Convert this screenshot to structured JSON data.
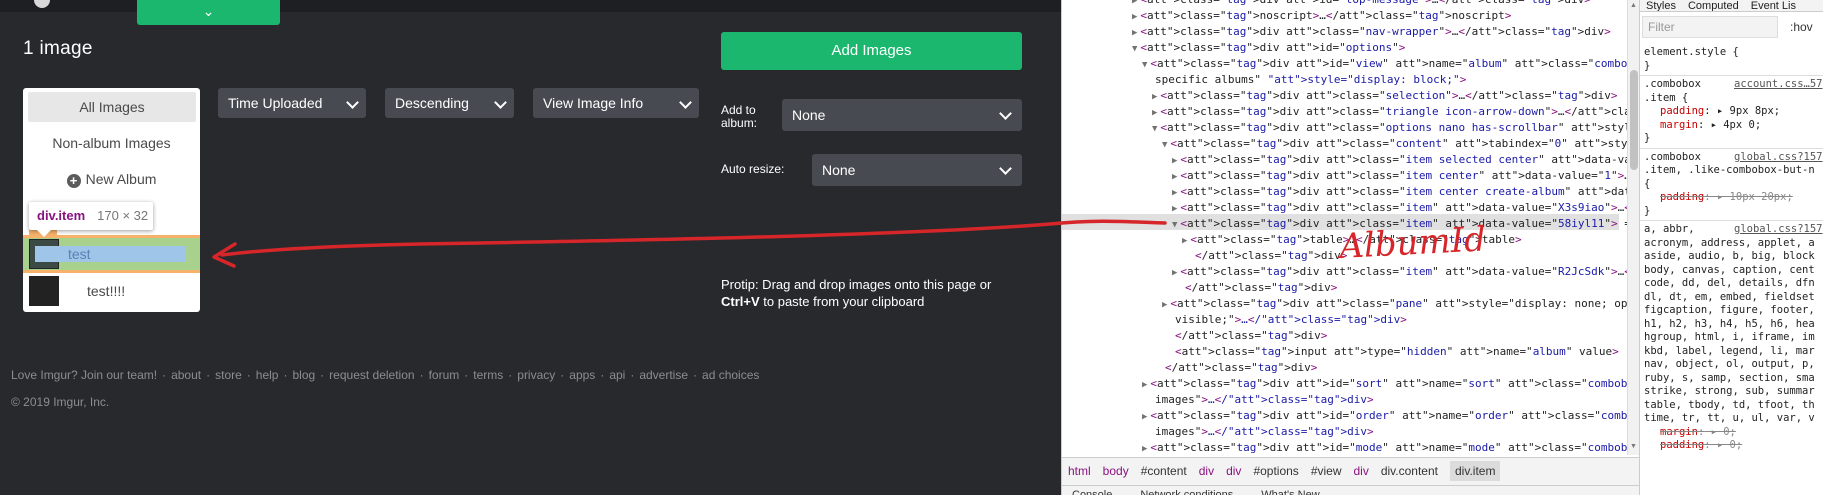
{
  "page": {
    "dropdown_tab_icon": "chevron-down-icon",
    "images_count": "1 image",
    "sort_combo": "Time Uploaded",
    "order_combo": "Descending",
    "mode_combo": "View Image Info",
    "menu": {
      "all_images": "All Images",
      "non_album": "Non-album Images",
      "new_album": "New Album",
      "item_test": "test",
      "item_test2": "test!!!!"
    },
    "tooltip": {
      "name": "div.item",
      "size": "170 × 32"
    },
    "add_images": "Add Images",
    "add_to_album_label": "Add to album:",
    "album_value": "None",
    "auto_resize_label": "Auto resize:",
    "resize_value": "None",
    "protip_text": "Protip: Drag and drop images onto this page or",
    "protip_key": "Ctrl+V",
    "protip_rest": " to paste from your clipboard",
    "footer_links": [
      "Love Imgur? Join our team!",
      "about",
      "store",
      "help",
      "blog",
      "request deletion",
      "forum",
      "terms",
      "privacy",
      "apps",
      "api",
      "advertise",
      "ad choices"
    ],
    "copyright": "© 2019 Imgur, Inc."
  },
  "devtools": {
    "elements_lines": [
      "<div id=\"top-message\">…</div>",
      "<noscript>…</noscript>",
      "<div class=\"nav-wrapper\">…</div>",
      "<div id=\"options\">",
      "<div id=\"view\" name=\"album\" class=\"combobox left opened\" title=\"View",
      "specific albums\" style=\"display: block;\">",
      "<div class=\"selection\">…</div>",
      "<div class=\"triangle icon-arrow-down\">…</div>",
      "<div class=\"options nano has-scrollbar\" style=\"height: 224px;\">",
      "<div class=\"content\" tabindex=\"0\" style=\"right: -17px;\">",
      "<div class=\"item selected center\" data-value=\"0\">…</div>",
      "<div class=\"item center\" data-value=\"1\">…</div>",
      "<div class=\"item center create-album\" data-value=\"new\">…</div>",
      "<div class=\"item\" data-value=\"X3s9iao\">…</div>",
      "<div class=\"item\" data-value=\"58iyl11\"> == $0",
      "<table>…</table>",
      "</div>",
      "<div class=\"item\" data-value=\"R2JcSdk\">…</div>",
      "</div>",
      "<div class=\"pane\" style=\"display: none; opacity: 1; visibility:",
      "visible;\">…</div>",
      "</div>",
      "<input type=\"hidden\" name=\"album\" value>",
      "</div>",
      "<div id=\"sort\" name=\"sort\" class=\"combobox left\" title=\"sort your",
      "images\">…</div>",
      "<div id=\"order\" name=\"order\" class=\"combobox left\" title=\"order your",
      "images\">…</div>",
      "<div id=\"mode\" name=\"mode\" class=\"combobox left\" title=\"what to do with"
    ],
    "breadcrumb": [
      "html",
      "body",
      "#content",
      "div",
      "div",
      "#options",
      "#view",
      "div",
      "div.content",
      "div.item"
    ],
    "drawer_tabs": [
      "Console",
      "Network conditions",
      "What's New"
    ],
    "styles_tabs": [
      "Styles",
      "Computed",
      "Event Lis"
    ],
    "filter_placeholder": "Filter",
    "hov": ":hov",
    "styles_lines": [
      "element.style {",
      "}",
      ".combobox",
      ".item {",
      "padding: ▸ 9px 8px;",
      "margin: ▸ 4px 0;",
      "}",
      ".combobox",
      ".item, .like-combobox-but-n",
      "{",
      "padding: ▸ 10px 20px;",
      "}",
      "a, abbr,",
      "acronym, address, applet, a",
      "aside, audio, b, big, block",
      "body, canvas, caption, cent",
      "code, dd, del, details, dfn",
      "dl, dt, em, embed, fieldset",
      "figcaption, figure, footer,",
      "h1, h2, h3, h4, h5, h6, hea",
      "hgroup, html, i, iframe, im",
      "kbd, label, legend, li, mar",
      "nav, object, ol, output, p,",
      "ruby, s, samp, section, sma",
      "strike, strong, sub, summar",
      "table, tbody, td, tfoot, th",
      "time, tr, tt, u, ul, var, v",
      "margin: ▸ 0;",
      "padding: ▸ 0;"
    ],
    "style_links": [
      "account.css…57",
      "global.css?157",
      "global.css?157"
    ]
  },
  "annotation": {
    "handwritten_text": "AlbumId",
    "color": "#d6262a"
  }
}
